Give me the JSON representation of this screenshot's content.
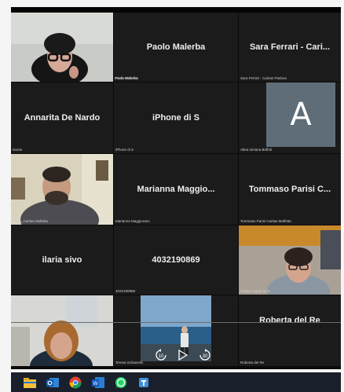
{
  "participants": [
    {
      "display": "",
      "label": "Paolo Malerba"
    },
    {
      "display": "Paolo Malerba",
      "label": "Paolo Malerba"
    },
    {
      "display": "Sara Ferrari - Cari...",
      "label": "Sara Ferrari - Caritas Padova"
    },
    {
      "display": "Annarita De Nardo",
      "label": "Nardo"
    },
    {
      "display": "iPhone di S",
      "label": "iPhone di S"
    },
    {
      "display": "",
      "label": "Altea miriana Boffoli",
      "avatar_letter": "A"
    },
    {
      "display": "",
      "label": "orgila_Caritas Molfetta"
    },
    {
      "display": "Marianna Maggio...",
      "label": "Marianna Maggiorano"
    },
    {
      "display": "Tommaso Parisi C...",
      "label": "Tommaso Parisi Caritas Molfetta"
    },
    {
      "display": "ilaria sivo",
      "label": ""
    },
    {
      "display": "4032190869",
      "label": "4032190869"
    },
    {
      "display": "",
      "label": "Giada Angela Simo"
    },
    {
      "display": "",
      "label": ""
    },
    {
      "display": "",
      "label": "Teresa Schiavello"
    },
    {
      "display": "Roberta del Re",
      "label": "Roberta del Re"
    }
  ],
  "media_controls": {
    "rewind": "10",
    "forward": "30"
  },
  "taskbar": {
    "icons": [
      "file-explorer-icon",
      "outlook-icon",
      "chrome-icon",
      "word-icon",
      "whatsapp-icon",
      "teams-icon"
    ]
  },
  "colors": {
    "tile_bg": "#1b1b1b",
    "avatar_bg": "#5f6d78",
    "taskbar_bg": "#1a1f2c"
  }
}
